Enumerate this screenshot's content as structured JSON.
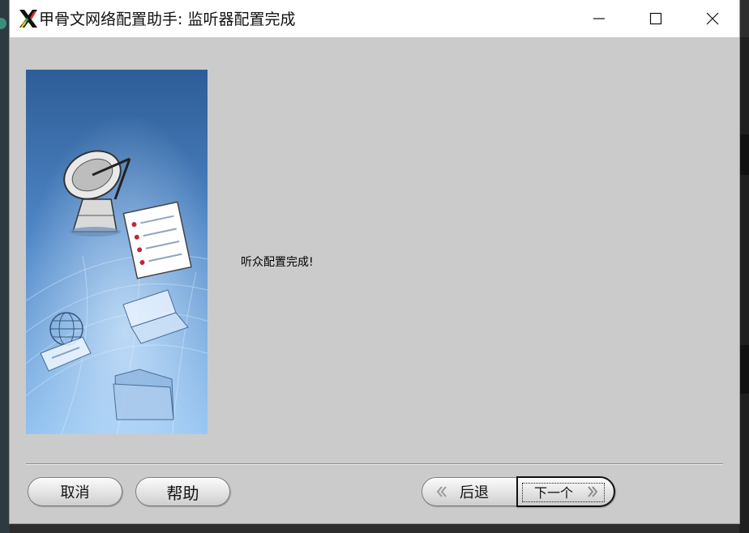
{
  "window": {
    "title": "甲骨文网络配置助手: 监听器配置完成",
    "icon": "oracle-x-logo-icon",
    "controls": {
      "minimize": "minimize-icon",
      "maximize": "maximize-icon",
      "close": "close-icon"
    }
  },
  "content": {
    "message": "听众配置完成!"
  },
  "buttons": {
    "cancel": "取消",
    "help": "帮助",
    "back": "后退",
    "next": "下一个"
  },
  "colors": {
    "window_bg": "#cbcbcb",
    "titlebar_bg": "#ffffff",
    "side_image_top": "#2d5d97",
    "side_image_bottom": "#8ec0f0"
  }
}
